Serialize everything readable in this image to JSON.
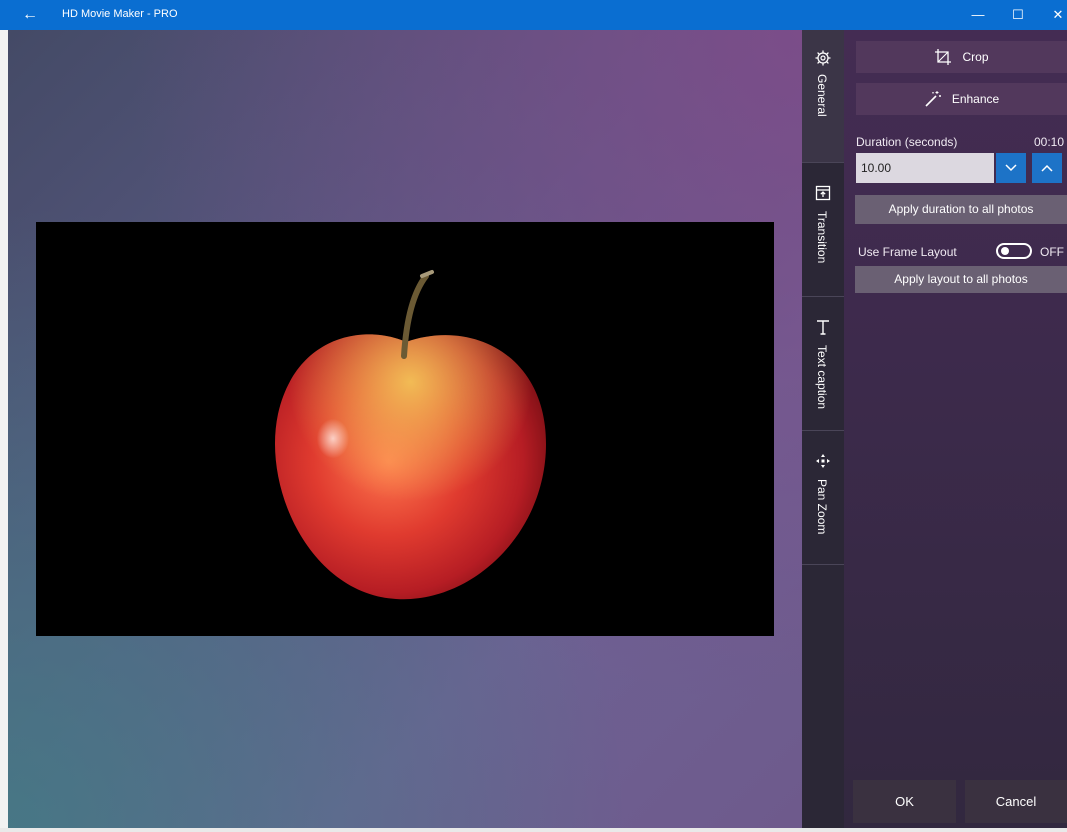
{
  "titlebar": {
    "back_icon": "←",
    "title": "HD Movie Maker - PRO",
    "min_icon": "—",
    "max_icon": "☐",
    "close_icon": "✕",
    "accent": "#0a6ed1"
  },
  "tabs": [
    {
      "label": "General",
      "icon": "gear-icon"
    },
    {
      "label": "Transition",
      "icon": "transition-icon"
    },
    {
      "label": "Text caption",
      "icon": "text-icon"
    },
    {
      "label": "Pan Zoom",
      "icon": "pan-zoom-icon"
    }
  ],
  "panel": {
    "crop_label": "Crop",
    "enhance_label": "Enhance",
    "duration_label": "Duration (seconds)",
    "duration_time": "00:10",
    "duration_value": "10.00",
    "apply_duration_label": "Apply duration to all photos",
    "frame_layout_label": "Use Frame Layout",
    "frame_layout_state": "OFF",
    "apply_layout_label": "Apply layout to all photos",
    "ok_label": "OK",
    "cancel_label": "Cancel"
  },
  "colors": {
    "panel_bg": "#3d2a4c",
    "tab_bg": "#2b2736",
    "stepper": "#1d73c7"
  }
}
